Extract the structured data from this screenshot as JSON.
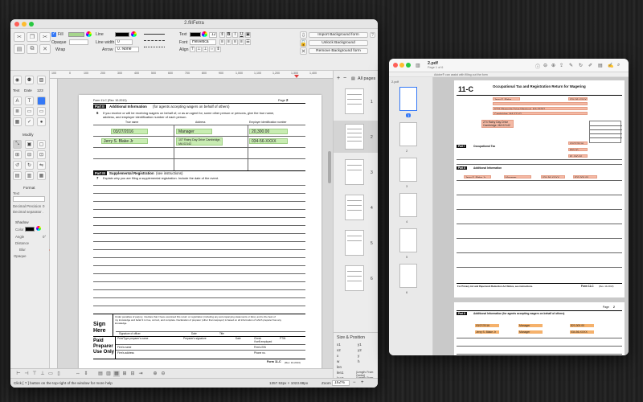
{
  "main_window": {
    "title": "2.fillFetra",
    "toolbar": {
      "fill_label": "Fill",
      "opaque_label": "Opaque",
      "wrap_label": "Wrap",
      "line_label": "Line",
      "line_width_label": "Line width",
      "line_width_value": "0",
      "arrow_label": "Arrow",
      "arrow_value": "0. None",
      "text_label": "Text",
      "font_label": "Font",
      "font_value": "Helvetica",
      "font_size": "12",
      "align_label": "Align",
      "bold": "B",
      "italic": "I",
      "underline": "U",
      "import_bg": "Import Background form",
      "unlock_bg": "Unlock Background",
      "remove_bg": "Remove Background form",
      "colors": {
        "fill": "#a6d58c",
        "line": "#000000",
        "text": "#000000"
      }
    },
    "palette": {
      "text": "Text",
      "date": "Date",
      "number": "123",
      "modify": "Modify",
      "format": "Format",
      "text_field": "Text",
      "decimal_precision": "Decimal Precision",
      "decimal_precision_value": "0",
      "decimal_separator": "Decimal separator",
      "decimal_separator_value": ".",
      "shadow": "Shadow",
      "color": "Color",
      "angle": "Angle",
      "angle_value": "0°",
      "distance": "Distance",
      "blur": "Blur",
      "opaque": "Opaque"
    },
    "ruler": [
      "100",
      "0",
      "100",
      "200",
      "300",
      "400",
      "500",
      "600",
      "700",
      "800",
      "900",
      "1,000",
      "1,100",
      "1,200",
      "1,300",
      "1,400"
    ],
    "form": {
      "form_id": "Form 11-C (Rev. 10-2013)",
      "page_label": "Page",
      "page_num": "2",
      "part2_tag": "Part II",
      "part2_title": "Additional Information",
      "part2_sub": "(for agents accepting wagers on behalf of others)",
      "q6": "6",
      "q6_text_1": "If you receive or will be receiving wagers on behalf of, or as an agent for, some other person or persons, give the true name,",
      "q6_text_2": "address, and employer identification number of each person.",
      "col_name": "True name",
      "col_address": "Address",
      "col_ein": "Employer identification number",
      "date_value": "03/27/2016",
      "manager_value": "Manager",
      "amount_value": "20,300.00",
      "name_value": "Jerry S. Blake Jr",
      "address_value_1": "107 Rainy Day Drive Cambridge,",
      "address_value_2": "MA 02142",
      "ein_value": "034-56-XXXX",
      "part3_tag": "Part III",
      "part3_title": "Supplemental Registration",
      "part3_sub": "(see instructions)",
      "q7": "7",
      "q7_text": "Explain why you are filing a supplemental registration. Include the date of the event.",
      "perjury_1": "Under penalties of perjury, I declare that I have examined this return or registration (including any accompanying statements or lists), and to the best of",
      "perjury_2": "my knowledge and belief it is true, correct, and complete. Declaration of preparer (other than taxpayer) is based on all information of which preparer has any",
      "perjury_3": "knowledge.",
      "sign": "Sign",
      "here": "Here",
      "sig_officer": "Signature of officer",
      "date_lbl": "Date",
      "title_lbl": "Title",
      "paid": "Paid",
      "preparer": "Preparer",
      "use_only": "Use Only",
      "prep_name": "Print/Type preparer's name",
      "prep_sig": "Preparer's signature",
      "check_if": "Check",
      "self_emp": "if self-employed",
      "ptin": "PTIN",
      "firms_name": "Firm's name",
      "firms_ein": "Firm's EIN",
      "firms_address": "Firm's address",
      "phone": "Phone no.",
      "footer_form": "Form 11-C",
      "footer_rev": "(Rev. 10-2013)"
    },
    "thumbs": {
      "all_pages": "All pages",
      "pages": [
        "1",
        "2",
        "3",
        "4",
        "5",
        "6"
      ],
      "selected": "2"
    },
    "size_position": {
      "title": "Size & Position",
      "rows": [
        {
          "a": "x1",
          "b": "y1"
        },
        {
          "a": "x2",
          "b": "y2"
        },
        {
          "a": "x",
          "b": "y"
        },
        {
          "a": "w",
          "b": "h"
        },
        {
          "a": "len",
          "b": ""
        },
        {
          "a": "len1",
          "b": "(Length: From Center)"
        },
        {
          "a": "len2",
          "b": "(Length: From pt1, pt2)"
        }
      ],
      "angle": "Angle",
      "angle_value": "0"
    },
    "status": {
      "hint": "Click [ ? ] button on the top-right of the window for more help",
      "dims": "1357.53px × 1023.88px",
      "zoom_label": "Zoom",
      "zoom_value": "162%"
    }
  },
  "preview_window": {
    "title": "2.pdf",
    "subtitle": "Page 1 of 6",
    "subbar": "Adobe® can assist with filling out the form",
    "sidebar_label": "2.pdf",
    "pages": [
      "1",
      "2",
      "3",
      "4",
      "5",
      "6"
    ],
    "form": {
      "form_no": "11-C",
      "title": "Occupational Tax and Registration Return for Wagering",
      "name": "Jerry S. Blake",
      "address": "5234 Riverside Drive Westport, MA 09787",
      "city": "Cambridge, MA 02142",
      "ssn": "034-56-XXXX",
      "address2": "274 Rainy Day Drive",
      "city2": "Cambridge, MA 02142",
      "part1": "Part I",
      "part1_title": "Occupational Tax",
      "amount1": "$50.00",
      "date1": "03/27/2016",
      "amount2": "$1,000.00",
      "part2": "Part II",
      "part2_title": "Additional Information",
      "row_name": "Jerry S. Blake Jr",
      "row_title": "Manager",
      "row_ein": "034-56-XXXX",
      "row_amount": "$20,300.00",
      "footer": "For Privacy Act and Paperwork Reduction Act Notice, see instructions.",
      "footer_form": "Form 11-C",
      "footer_rev": "(Rev. 10-2013)",
      "p2_tag": "Part II",
      "p2_title": "Additional Information (for agents accepting wagers on behalf of others)",
      "p2_date": "03/27/2016",
      "p2_manager": "Manager",
      "p2_amount": "$20,300.00",
      "p2_name": "Jerry S. Blake Jr",
      "p2_ein": "034-56-XXXX",
      "page_label": "Page",
      "page_num": "2"
    }
  }
}
